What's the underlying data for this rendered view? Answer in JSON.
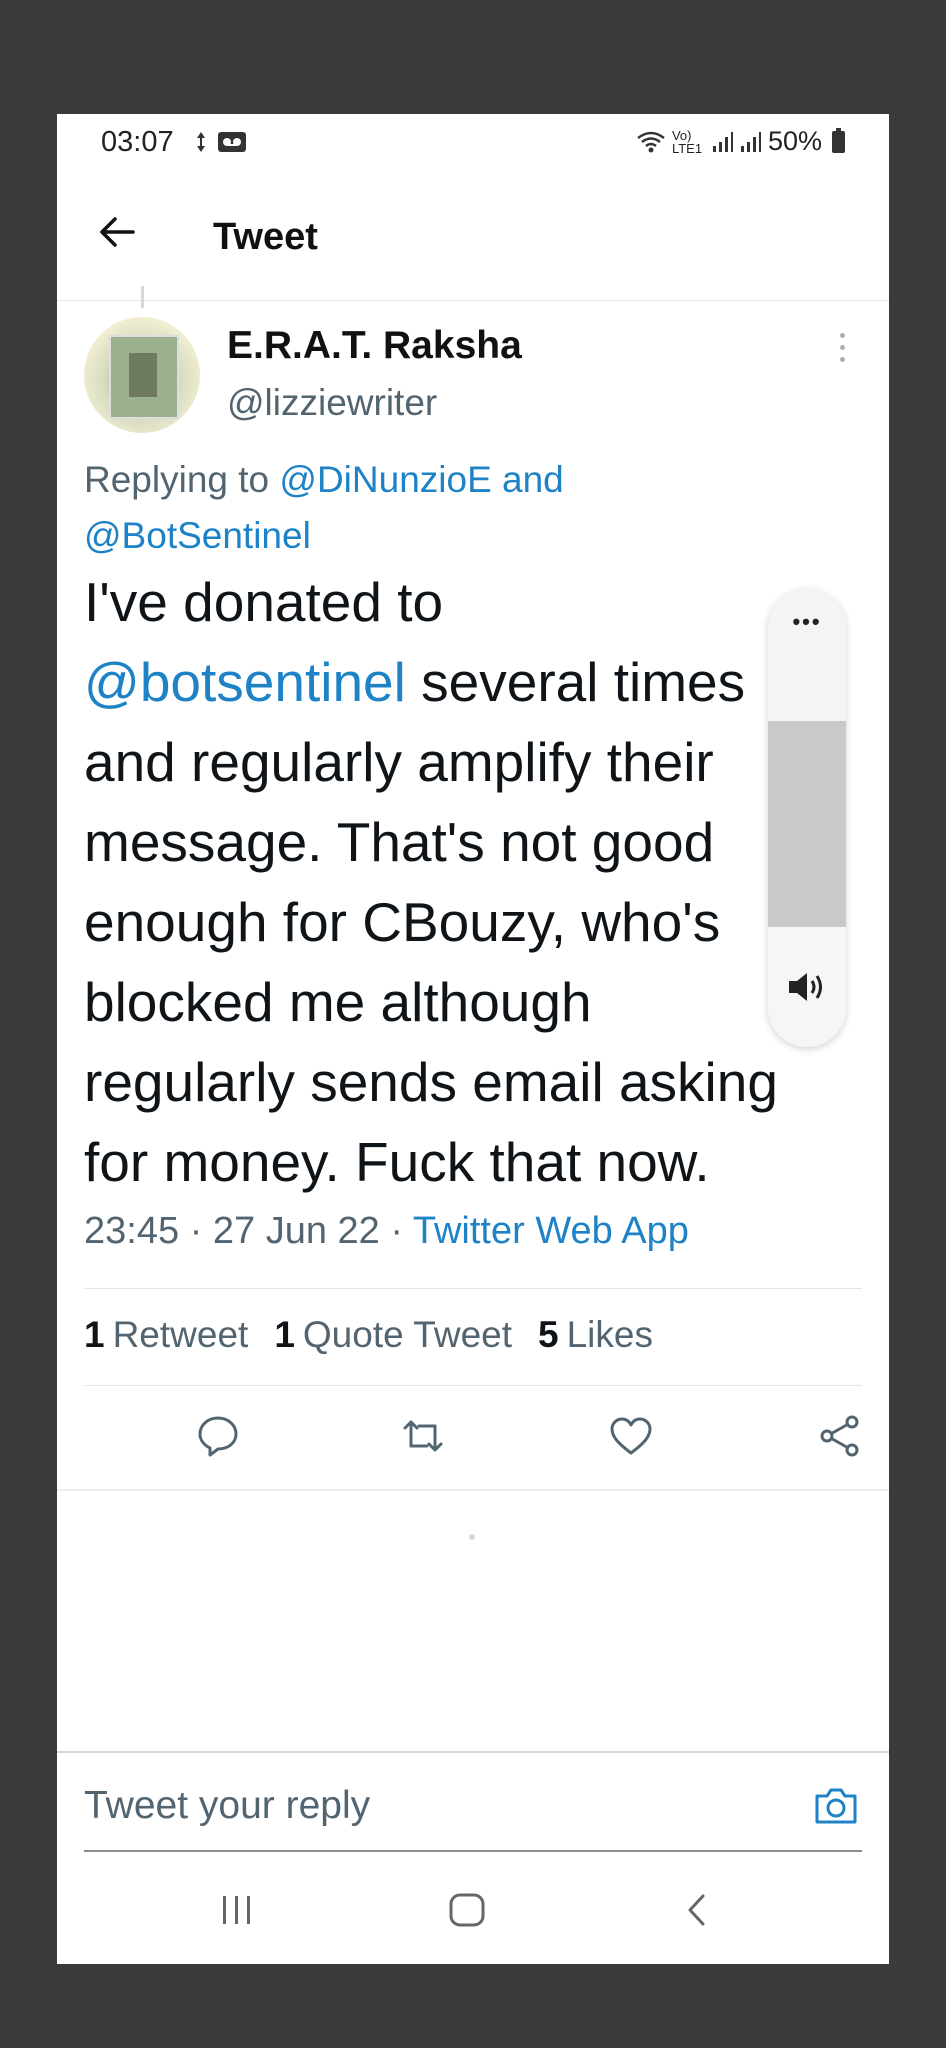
{
  "status_bar": {
    "time": "03:07",
    "network": "Vo) LTE1",
    "battery": "50%"
  },
  "header": {
    "title": "Tweet"
  },
  "tweet": {
    "author_name": "E.R.A.T. Raksha",
    "author_handle": "@lizziewriter",
    "replying_prefix": "Replying to",
    "reply_to_1": "@DiNunzioE",
    "reply_to_and": "and",
    "reply_to_2": "@BotSentinel",
    "text_line1": "I've donated to",
    "text_mention": "@botsentinel",
    "text_line2_rest": " several times",
    "text_line3": "and regularly amplify their",
    "text_line4": "message. That's not good",
    "text_line5": "enough for CBouzy, who's",
    "text_line6": "blocked me although",
    "text_line7": "regularly sends email asking",
    "text_line8": "for money. Fuck that now.",
    "timestamp": "23:45 · 27 Jun 22 · ",
    "source": "Twitter Web App",
    "stats": {
      "retweets_count": "1",
      "retweets_label": "Retweet",
      "quotes_count": "1",
      "quotes_label": "Quote Tweet",
      "likes_count": "5",
      "likes_label": "Likes"
    }
  },
  "volume_overlay": {
    "menu": "•••",
    "level": 0.55
  },
  "reply_box": {
    "placeholder": "Tweet your reply"
  },
  "colors": {
    "link": "#1d82c6",
    "text": "#0f1419",
    "muted": "#536471"
  }
}
